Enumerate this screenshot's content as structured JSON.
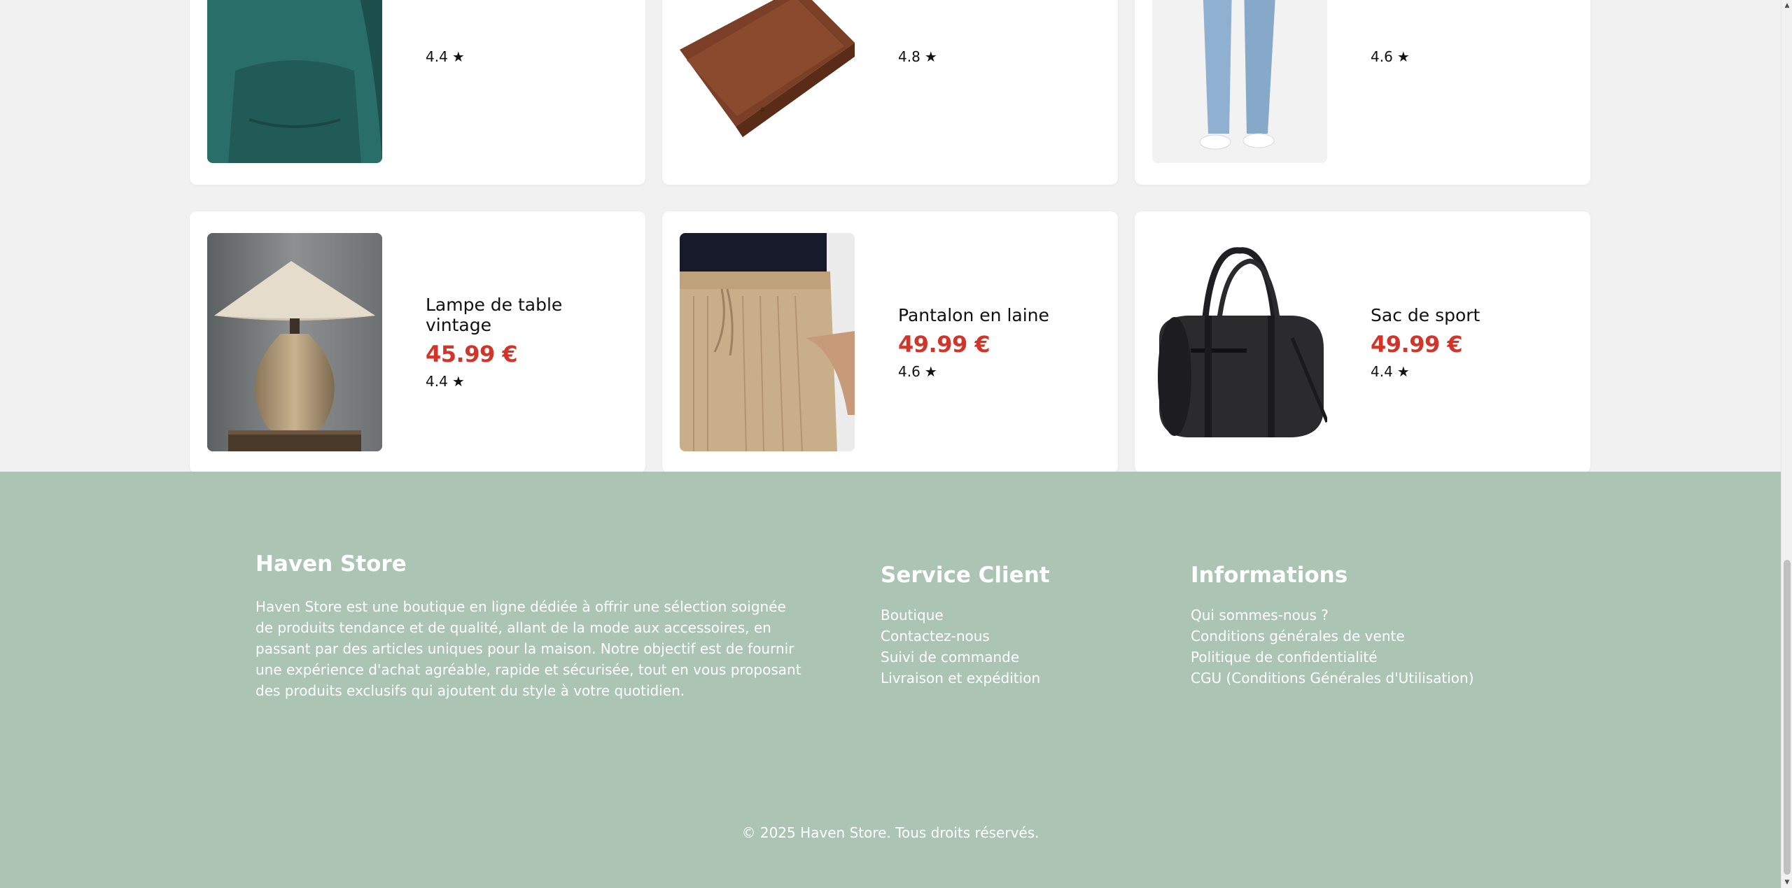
{
  "products": [
    {
      "name": "",
      "price": "",
      "rating": "4.4",
      "image_icon": "green-hoodie-image"
    },
    {
      "name": "",
      "price": "",
      "rating": "4.8",
      "image_icon": "leather-wallet-image"
    },
    {
      "name": "",
      "price": "",
      "rating": "4.6",
      "image_icon": "jeans-image"
    },
    {
      "name": "Lampe de table vintage",
      "price": "45.99 €",
      "rating": "4.4",
      "image_icon": "table-lamp-image"
    },
    {
      "name": "Pantalon en laine",
      "price": "49.99 €",
      "rating": "4.6",
      "image_icon": "wool-pants-image"
    },
    {
      "name": "Sac de sport",
      "price": "49.99 €",
      "rating": "4.4",
      "image_icon": "sport-bag-image"
    }
  ],
  "colors": {
    "price": "#d2342a",
    "footer_bg": "#abc4b4",
    "page_bg": "#f1f1f1"
  },
  "footer": {
    "brand_title": "Haven Store",
    "brand_description": "Haven Store est une boutique en ligne dédiée à offrir une sélection soignée de produits tendance et de qualité, allant de la mode aux accessoires, en passant par des articles uniques pour la maison. Notre objectif est de fournir une expérience d'achat agréable, rapide et sécurisée, tout en vous proposant des produits exclusifs qui ajoutent du style à votre quotidien.",
    "service": {
      "title": "Service Client",
      "links": [
        "Boutique",
        "Contactez-nous",
        "Suivi de commande",
        "Livraison et expédition"
      ]
    },
    "info": {
      "title": "Informations",
      "links": [
        "Qui sommes-nous ?",
        "Conditions générales de vente",
        "Politique de confidentialité",
        "CGU (Conditions Générales d'Utilisation)"
      ]
    },
    "copyright": "© 2025 Haven Store. Tous droits réservés."
  }
}
